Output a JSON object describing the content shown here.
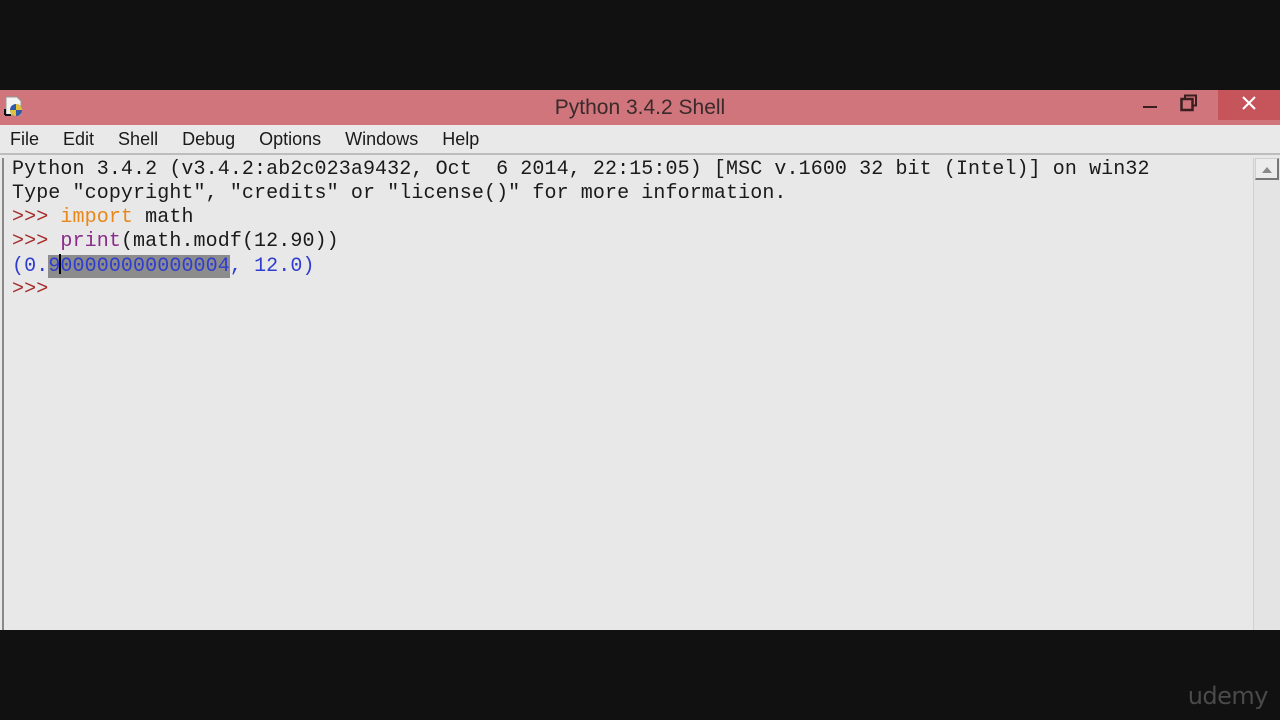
{
  "window": {
    "title": "Python 3.4.2 Shell",
    "icons": {
      "app": "idle-python-icon",
      "minimize": "minimize-icon",
      "maximize": "restore-icon",
      "close": "close-icon"
    },
    "colors": {
      "titlebar": "#cf757b",
      "close_button": "#c5545b",
      "background": "#e8e8e8"
    }
  },
  "menu": {
    "items": [
      {
        "label": "File"
      },
      {
        "label": "Edit"
      },
      {
        "label": "Shell"
      },
      {
        "label": "Debug"
      },
      {
        "label": "Options"
      },
      {
        "label": "Windows"
      },
      {
        "label": "Help"
      }
    ]
  },
  "shell": {
    "banner_line1": "Python 3.4.2 (v3.4.2:ab2c023a9432, Oct  6 2014, 22:15:05) [MSC v.1600 32 bit (Intel)] on win32",
    "banner_line2": "Type \"copyright\", \"credits\" or \"license()\" for more information.",
    "prompt": ">>> ",
    "line3": {
      "keyword": "import",
      "rest": " math"
    },
    "line4": {
      "builtin": "print",
      "rest": "(math.modf(12.90))"
    },
    "output": {
      "open": "(0.",
      "sel_before_cursor": "9",
      "sel_after_cursor": "00000000000004",
      "close": ", 12.0)"
    },
    "colors": {
      "prompt": "#a52a2a",
      "keyword": "#e9871a",
      "builtin": "#8a2a8a",
      "output": "#2e3cd0",
      "selection": "#8c8c8c"
    }
  },
  "scrollbar": {
    "up_arrow_icon": "scroll-up-arrow-icon"
  },
  "watermark": "udemy"
}
